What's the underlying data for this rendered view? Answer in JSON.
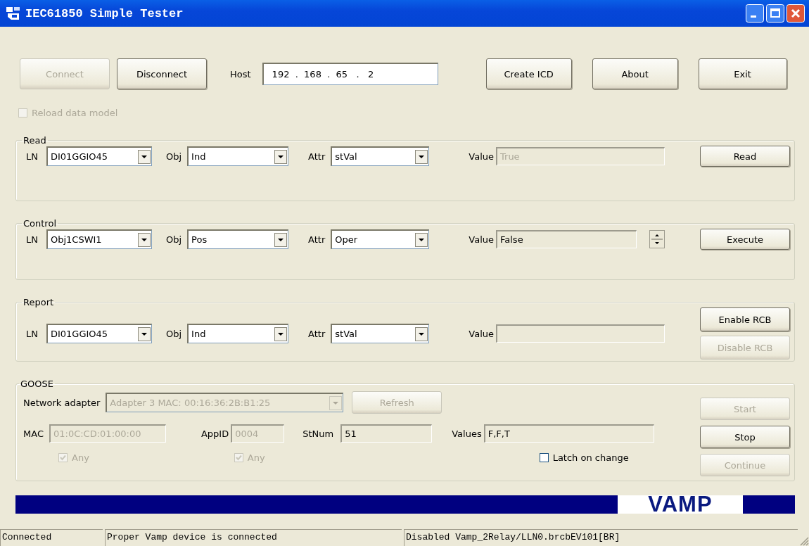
{
  "window": {
    "title": "IEC61850 Simple Tester"
  },
  "toolbar": {
    "left_buttons": [
      {
        "label": "Connect",
        "disabled": true
      },
      {
        "label": "Disconnect",
        "disabled": false
      }
    ],
    "host_label": "Host",
    "host": "192  .  168  .  65   .   2",
    "right_buttons": [
      {
        "label": "Create ICD",
        "disabled": false
      },
      {
        "label": "About",
        "disabled": false
      },
      {
        "label": "Exit",
        "disabled": false
      }
    ]
  },
  "reload_checkbox": {
    "label": "Reload data model",
    "checked": false,
    "disabled": true
  },
  "groups": [
    {
      "title": "Read",
      "kind": "text",
      "ln_label": "LN",
      "ln": "DI01GGIO45",
      "obj_label": "Obj",
      "obj": "Ind",
      "attr_label": "Attr",
      "attr": "stVal",
      "value_label": "Value",
      "value": "True",
      "value_disabled": true,
      "buttons": [
        {
          "label": "Read",
          "disabled": false
        }
      ]
    },
    {
      "title": "Control",
      "kind": "spin",
      "ln_label": "LN",
      "ln": "Obj1CSWI1",
      "obj_label": "Obj",
      "obj": "Pos",
      "attr_label": "Attr",
      "attr": "Oper",
      "value_label": "Value",
      "value": "False",
      "value_disabled": false,
      "buttons": [
        {
          "label": "Execute",
          "disabled": false
        }
      ]
    },
    {
      "title": "Report",
      "kind": "text",
      "ln_label": "LN",
      "ln": "DI01GGIO45",
      "obj_label": "Obj",
      "obj": "Ind",
      "attr_label": "Attr",
      "attr": "stVal",
      "value_label": "Value",
      "value_disabled": false,
      "buttons": [
        {
          "label": "Enable RCB",
          "disabled": false
        },
        {
          "label": "Disable RCB",
          "disabled": true
        }
      ]
    }
  ],
  "goose": {
    "title": "GOOSE",
    "adapter_label": "Network adapter",
    "adapter": "Adapter 3 MAC: 00:16:36:2B:B1:25",
    "adapter_disabled": true,
    "refresh": {
      "label": "Refresh",
      "disabled": true
    },
    "mac_label": "MAC",
    "mac": "01:0C:CD:01:00:00",
    "mac_disabled": true,
    "appid_label": "AppID",
    "appid": "0004",
    "appid_disabled": true,
    "stnum_label": "StNum",
    "stnum": "51",
    "values_label": "Values",
    "values": "F,F,T",
    "mac_any": {
      "label": "Any",
      "checked": true,
      "disabled": true
    },
    "appid_any": {
      "label": "Any",
      "checked": true,
      "disabled": true
    },
    "latch": {
      "label": "Latch on change",
      "checked": false,
      "disabled": false
    },
    "buttons": [
      {
        "label": "Start",
        "disabled": true
      },
      {
        "label": "Stop",
        "disabled": false
      },
      {
        "label": "Continue",
        "disabled": true
      }
    ]
  },
  "banner": {
    "logo": "VAMP"
  },
  "status_bar": [
    "Connected",
    "Proper Vamp device is connected",
    "Disabled Vamp_2Relay/LLN0.brcbEV101[BR]"
  ]
}
